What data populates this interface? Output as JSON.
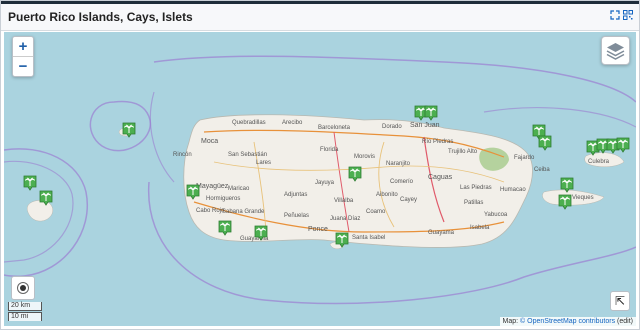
{
  "header": {
    "title": "Puerto Rico Islands, Cays, Islets"
  },
  "controls": {
    "zoom_in": "+",
    "zoom_out": "−",
    "fullscreen_symbol": "⇱",
    "icons": [
      "expand-icon",
      "qr-code-icon",
      "layers-icon",
      "locate-icon",
      "palm-tree-marker-icon"
    ]
  },
  "scale": {
    "metric": "20 km",
    "imperial": "10 mi"
  },
  "attribution": {
    "prefix": "Map: ",
    "link": "© OpenStreetMap contributors",
    "suffix": " (edit)"
  },
  "colors": {
    "water": "#aad3df",
    "land": "#f2efe9",
    "marker": "#4caf50",
    "boundary": "#9b7fd1",
    "road": "#e8913a"
  },
  "places": [
    {
      "name": "Quebradillas"
    },
    {
      "name": "Arecibo"
    },
    {
      "name": "Barceloneta"
    },
    {
      "name": "Dorado"
    },
    {
      "name": "San Juan"
    },
    {
      "name": "Rincón"
    },
    {
      "name": "Moca"
    },
    {
      "name": "San Sebastián"
    },
    {
      "name": "Lares"
    },
    {
      "name": "Florida"
    },
    {
      "name": "Morovis"
    },
    {
      "name": "Naranjito"
    },
    {
      "name": "Río Piedras"
    },
    {
      "name": "Trujillo Alto"
    },
    {
      "name": "Fajardo"
    },
    {
      "name": "Culebra"
    },
    {
      "name": "Mayagüez"
    },
    {
      "name": "Maricao"
    },
    {
      "name": "Adjuntas"
    },
    {
      "name": "Jayuya"
    },
    {
      "name": "Comerío"
    },
    {
      "name": "Caguas"
    },
    {
      "name": "Las Piedras"
    },
    {
      "name": "Humacao"
    },
    {
      "name": "Cabo Rojo"
    },
    {
      "name": "Sabana Grande"
    },
    {
      "name": "Peñuelas"
    },
    {
      "name": "Villalba"
    },
    {
      "name": "Cayey"
    },
    {
      "name": "Juana Díaz"
    },
    {
      "name": "Coamo"
    },
    {
      "name": "Guayama"
    },
    {
      "name": "Patillas"
    },
    {
      "name": "Ponce"
    },
    {
      "name": "Santa Isabel"
    },
    {
      "name": "Guayanilla"
    },
    {
      "name": "Hormigueros"
    },
    {
      "name": "Isabela"
    },
    {
      "name": "Ceiba"
    },
    {
      "name": "Aibonito"
    },
    {
      "name": "Yabucoa"
    },
    {
      "name": "Vieques"
    }
  ]
}
